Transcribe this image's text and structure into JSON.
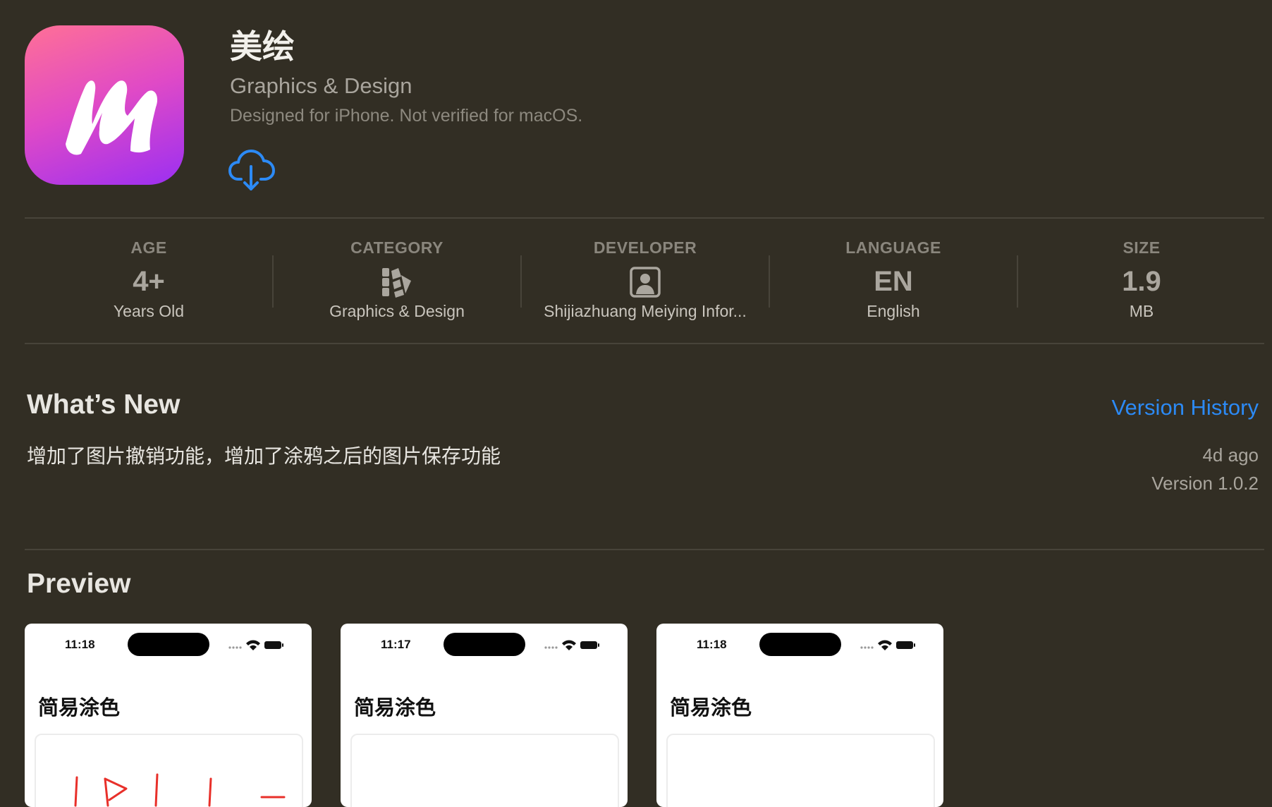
{
  "app": {
    "title": "美绘",
    "subtitle": "Graphics & Design",
    "compat_note": "Designed for iPhone. Not verified for macOS.",
    "icon": "app-logo-m",
    "get_icon": "cloud-download-icon"
  },
  "stats": [
    {
      "label": "AGE",
      "value": "4+",
      "sub": "Years Old"
    },
    {
      "label": "CATEGORY",
      "icon": "category-icon",
      "sub": "Graphics & Design"
    },
    {
      "label": "DEVELOPER",
      "icon": "developer-person-icon",
      "sub": "Shijiazhuang Meiying Infor..."
    },
    {
      "label": "LANGUAGE",
      "value": "EN",
      "sub": "English"
    },
    {
      "label": "SIZE",
      "value": "1.9",
      "sub": "MB"
    }
  ],
  "whats_new": {
    "title": "What’s New",
    "version_history_label": "Version History",
    "notes": "增加了图片撤销功能，增加了涂鸦之后的图片保存功能",
    "date": "4d ago",
    "version": "Version 1.0.2"
  },
  "preview": {
    "title": "Preview",
    "screenshots": [
      {
        "time": "11:18",
        "heading": "简易涂色"
      },
      {
        "time": "11:17",
        "heading": "简易涂色"
      },
      {
        "time": "11:18",
        "heading": "简易涂色"
      }
    ]
  },
  "colors": {
    "background": "#322e24",
    "accent": "#2c8af5",
    "icon_gradient": [
      "#ff7096",
      "#e04ac6",
      "#9b2ff2"
    ],
    "doodle_red": "#e8302a"
  }
}
